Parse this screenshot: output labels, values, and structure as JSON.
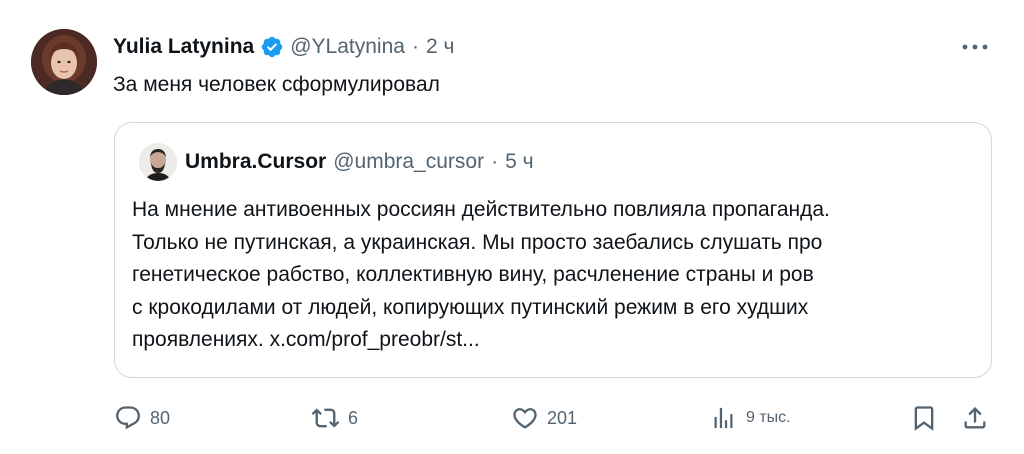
{
  "tweet": {
    "author_name": "Yulia Latynina",
    "author_handle": "@YLatynina",
    "separator": "·",
    "time": "2 ч",
    "text": "За меня человек сформулировал",
    "verified": true
  },
  "quote": {
    "author_name": "Umbra.Cursor",
    "author_handle": "@umbra_cursor",
    "separator": "·",
    "time": "5 ч",
    "text": "На мнение антивоенных россиян действительно  повлияла пропаганда.\nТолько не путинская, а украинская. Мы просто заебались слушать про\nгенетическое рабство, коллективную вину, расчленение страны и ров\nс крокодилами от людей, копирующих путинский режим в его худших\nпроявлениях. x.com/prof_preobr/st..."
  },
  "actions": {
    "replies": "80",
    "reposts": "6",
    "likes": "201",
    "views": "9 тыс."
  },
  "colors": {
    "text_primary": "#0f1419",
    "text_secondary": "#536471",
    "verified_blue": "#1d9bf0",
    "border": "#cfd9de"
  },
  "icons": [
    "more-icon",
    "verified-badge-icon",
    "reply-icon",
    "repost-icon",
    "like-icon",
    "views-icon",
    "bookmark-icon",
    "share-icon"
  ]
}
